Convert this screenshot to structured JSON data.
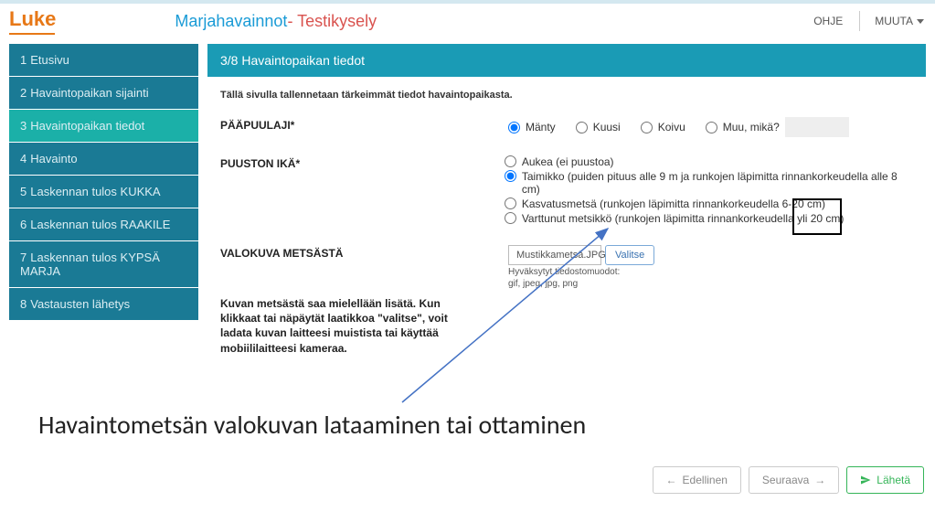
{
  "header": {
    "logo_text": "Luke",
    "title_part1": "Marjahavainnot",
    "title_part2": "- Testikysely",
    "help_label": "OHJE",
    "change_label": "MUUTA"
  },
  "sidebar": {
    "items": [
      {
        "num": "1",
        "label": "Etusivu"
      },
      {
        "num": "2",
        "label": "Havaintopaikan sijainti"
      },
      {
        "num": "3",
        "label": "Havaintopaikan tiedot"
      },
      {
        "num": "4",
        "label": "Havainto"
      },
      {
        "num": "5",
        "label": "Laskennan tulos KUKKA"
      },
      {
        "num": "6",
        "label": "Laskennan tulos RAAKILE"
      },
      {
        "num": "7",
        "label": "Laskennan tulos KYPSÄ MARJA"
      },
      {
        "num": "8",
        "label": "Vastausten lähetys"
      }
    ]
  },
  "panel": {
    "header": "3/8 Havaintopaikan tiedot",
    "description": "Tällä sivulla tallennetaan tärkeimmät tiedot havaintopaikasta."
  },
  "form": {
    "paapuulaji": {
      "label": "PÄÄPUULAJI*",
      "options": {
        "manty": "Mänty",
        "kuusi": "Kuusi",
        "koivu": "Koivu",
        "muu": "Muu, mikä?"
      },
      "muu_value": ""
    },
    "puuston_ika": {
      "label": "PUUSTON IKÄ*",
      "options": {
        "aukea": "Aukea (ei puustoa)",
        "taimikko": "Taimikko (puiden pituus alle 9 m ja runkojen läpimitta rinnankorkeudella alle 8 cm)",
        "kasvatus": "Kasvatusmetsä (runkojen läpimitta rinnankorkeudella 6-20 cm)",
        "varttunut": "Varttunut metsikkö (runkojen läpimitta rinnankorkeudella yli 20 cm)"
      }
    },
    "valokuva": {
      "label": "VALOKUVA METSÄSTÄ",
      "file_name": "Mustikkametsä.JPG",
      "browse_label": "Valitse",
      "hint_line1": "Hyväksytyt tiedostomuodot:",
      "hint_line2": "gif, jpeg, jpg, png",
      "description": "Kuvan metsästä saa mielellään lisätä. Kun klikkaat tai näpäytät laatikkoa \"valitse\", voit ladata kuvan laitteesi muistista tai käyttää mobiililaitteesi kameraa."
    }
  },
  "annotation": "Havaintometsän valokuvan lataaminen tai ottaminen",
  "footer": {
    "prev": "Edellinen",
    "next": "Seuraava",
    "send": "Lähetä"
  }
}
